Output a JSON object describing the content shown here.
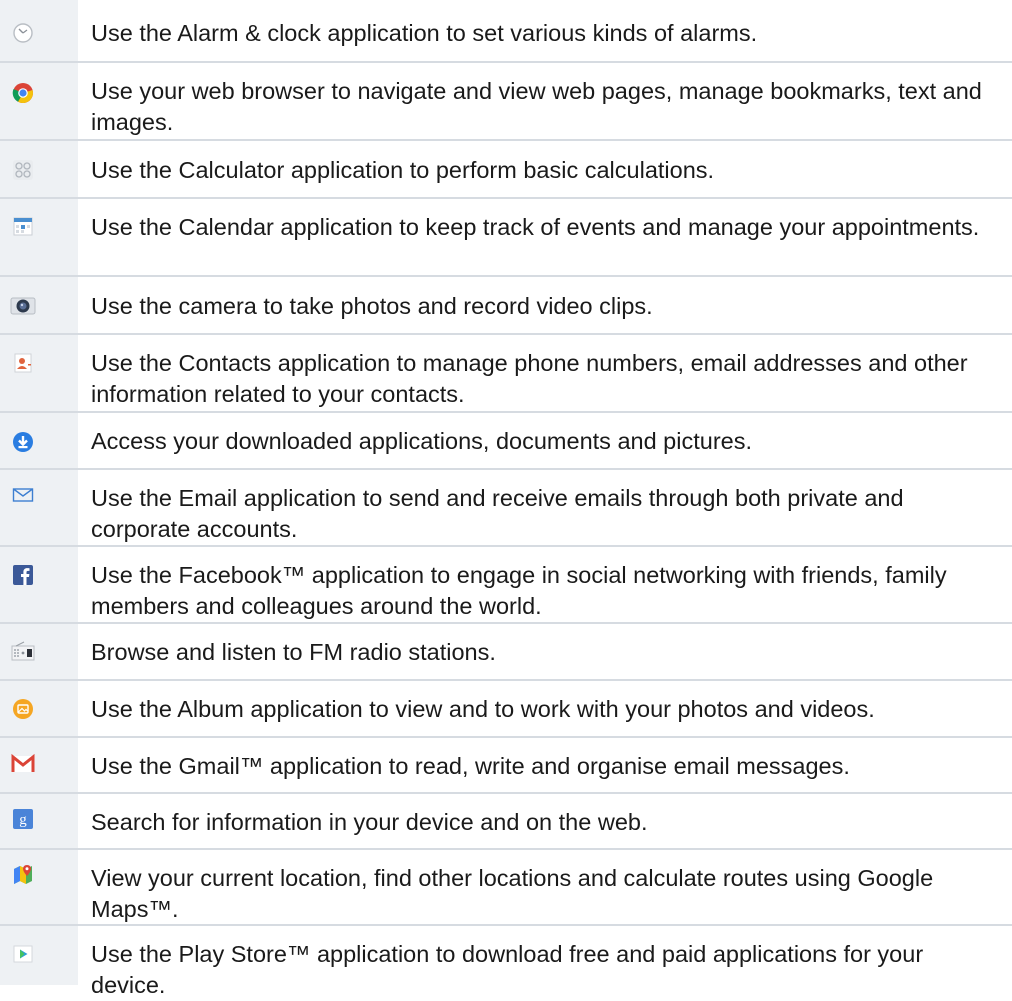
{
  "items": [
    {
      "icon": "alarm-clock-icon",
      "text": "Use the Alarm & clock application to set various kinds of alarms."
    },
    {
      "icon": "chrome-browser-icon",
      "text": "Use your web browser to navigate and view web pages, manage bookmarks, text and images."
    },
    {
      "icon": "calculator-icon",
      "text": "Use the Calculator application to perform basic calculations."
    },
    {
      "icon": "calendar-icon",
      "text": "Use the Calendar application to keep track of events and manage your appointments."
    },
    {
      "icon": "camera-icon",
      "text": "Use the camera to take photos and record video clips."
    },
    {
      "icon": "contacts-icon",
      "text": "Use the Contacts application to manage phone numbers, email addresses and other information related to your contacts."
    },
    {
      "icon": "downloads-icon",
      "text": "Access your downloaded applications, documents and pictures."
    },
    {
      "icon": "email-envelope-icon",
      "text": "Use the Email application to send and receive emails through both private and corporate accounts."
    },
    {
      "icon": "facebook-icon",
      "text": "Use the Facebook™ application to engage in social networking with friends, family members and colleagues around the world."
    },
    {
      "icon": "fm-radio-icon",
      "text": "Browse and listen to FM radio stations."
    },
    {
      "icon": "album-icon",
      "text": "Use the Album application to view and to work with your photos and videos."
    },
    {
      "icon": "gmail-icon",
      "text": "Use the Gmail™ application to read, write and organise email messages."
    },
    {
      "icon": "google-search-icon",
      "text": "Search for information in your device and on the web."
    },
    {
      "icon": "google-maps-icon",
      "text": "View your current location, find other locations and calculate routes using Google Maps™."
    },
    {
      "icon": "play-store-icon",
      "text": "Use the Play Store™ application to download free and paid applications for your device."
    }
  ]
}
